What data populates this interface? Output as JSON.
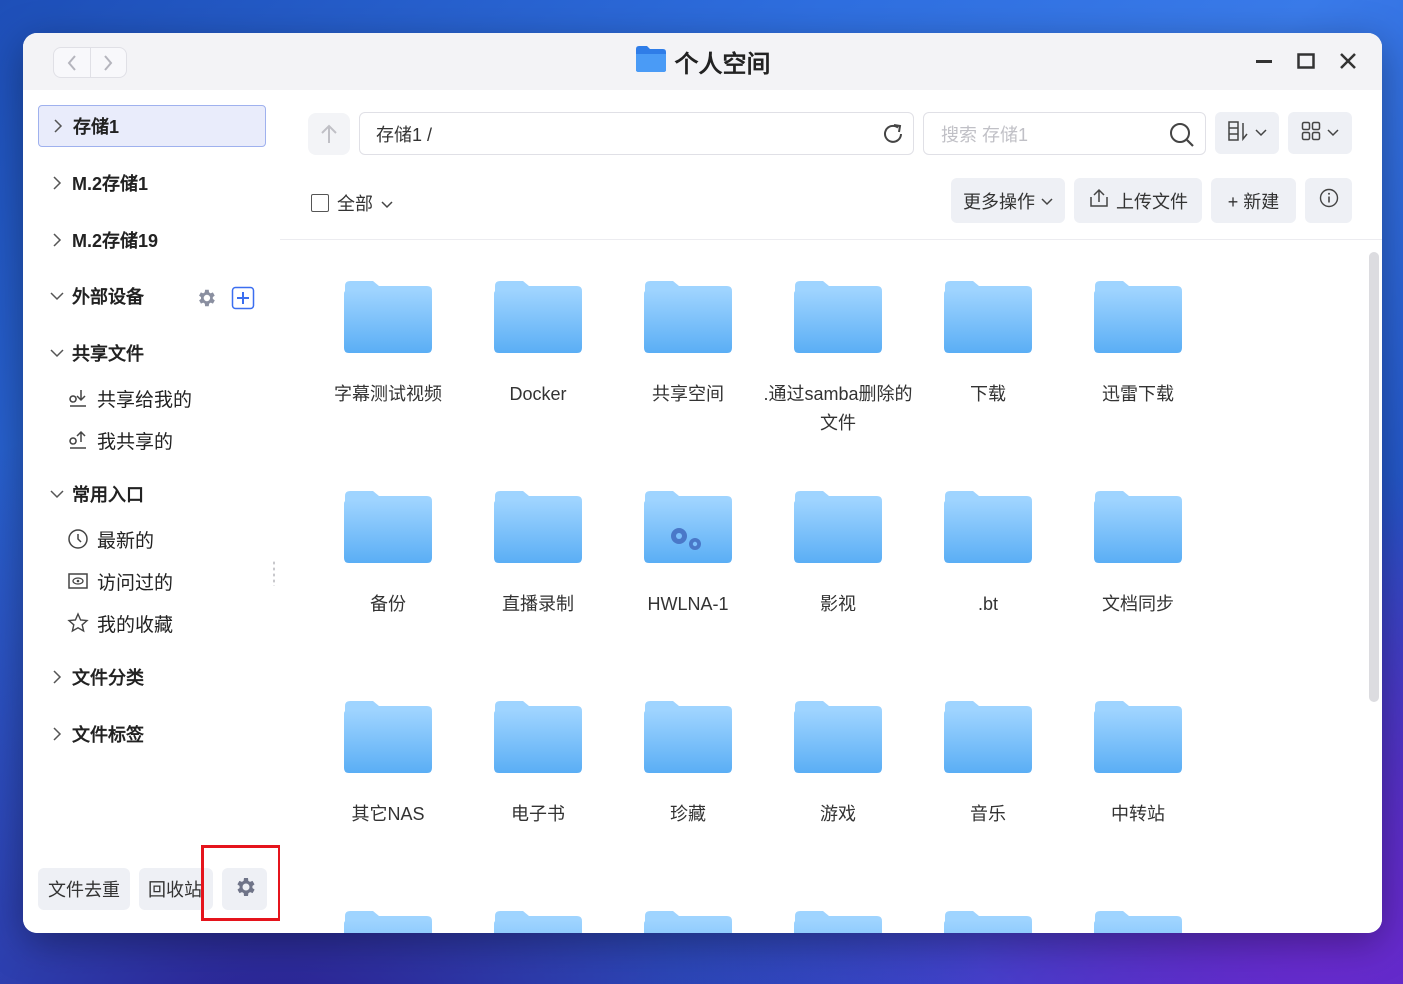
{
  "window": {
    "title": "个人空间",
    "title_icon": "folder-icon",
    "nav": {
      "back_icon": "chevron-left-icon",
      "forward_icon": "chevron-right-icon"
    },
    "controls": [
      "minimize-icon",
      "maximize-icon",
      "close-icon"
    ]
  },
  "sidebar": {
    "storages": [
      {
        "label": "存储1",
        "active": true
      },
      {
        "label": "M.2存储1",
        "active": false
      },
      {
        "label": "M.2存储19",
        "active": false
      }
    ],
    "external": {
      "label": "外部设备",
      "icons": [
        "gear-icon",
        "add-icon"
      ]
    },
    "shared": {
      "label": "共享文件",
      "items": [
        {
          "label": "共享给我的",
          "icon": "shared-with-me-icon"
        },
        {
          "label": "我共享的",
          "icon": "my-shares-icon"
        }
      ]
    },
    "common": {
      "label": "常用入口",
      "items": [
        {
          "label": "最新的",
          "icon": "clock-icon"
        },
        {
          "label": "访问过的",
          "icon": "eye-icon"
        },
        {
          "label": "我的收藏",
          "icon": "star-icon"
        }
      ]
    },
    "categories": {
      "label": "文件分类"
    },
    "tags": {
      "label": "文件标签"
    },
    "bottom": {
      "dedupe": "文件去重",
      "recycle": "回收站",
      "settings_icon": "gear-icon"
    }
  },
  "toolbar": {
    "path": "存储1 /",
    "search_placeholder": "搜索 存储1",
    "select_all": "全部",
    "more_actions": "更多操作",
    "upload": "上传文件",
    "new": "+ 新建"
  },
  "folders": [
    {
      "name": "字幕测试视频",
      "type": "folder"
    },
    {
      "name": "Docker",
      "type": "folder"
    },
    {
      "name": "共享空间",
      "type": "folder"
    },
    {
      "name": ".通过samba删除的文件",
      "type": "folder"
    },
    {
      "name": "下载",
      "type": "folder"
    },
    {
      "name": "迅雷下载",
      "type": "folder"
    },
    {
      "name": "备份",
      "type": "folder"
    },
    {
      "name": "直播录制",
      "type": "folder"
    },
    {
      "name": "HWLNA-1",
      "type": "system-folder"
    },
    {
      "name": "影视",
      "type": "folder"
    },
    {
      "name": ".bt",
      "type": "folder"
    },
    {
      "name": "文档同步",
      "type": "folder"
    },
    {
      "name": "其它NAS",
      "type": "folder"
    },
    {
      "name": "电子书",
      "type": "folder"
    },
    {
      "name": "珍藏",
      "type": "folder"
    },
    {
      "name": "游戏",
      "type": "folder"
    },
    {
      "name": "音乐",
      "type": "folder"
    },
    {
      "name": "中转站",
      "type": "folder"
    },
    {
      "name": "",
      "type": "folder"
    },
    {
      "name": "",
      "type": "folder"
    },
    {
      "name": "",
      "type": "folder"
    },
    {
      "name": "",
      "type": "folder"
    },
    {
      "name": "",
      "type": "folder"
    },
    {
      "name": "",
      "type": "folder"
    }
  ],
  "colors": {
    "folder_light": "#9fd4ff",
    "folder_dark": "#5aaef5",
    "highlight": "#e5141c",
    "accent": "#3b6ef0"
  }
}
